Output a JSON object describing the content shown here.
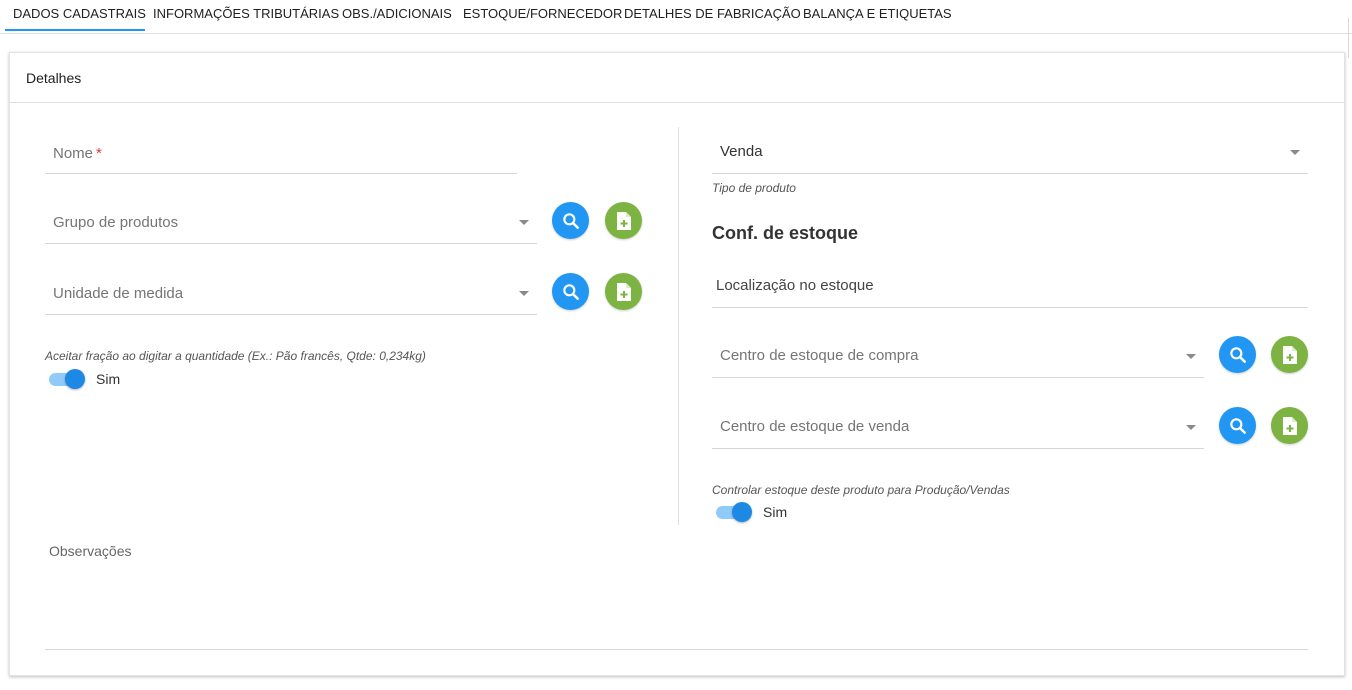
{
  "tabs": [
    {
      "label": "DADOS CADASTRAIS",
      "active": true
    },
    {
      "label": "INFORMAÇÕES TRIBUTÁRIAS",
      "active": false
    },
    {
      "label": "OBS./ADICIONAIS",
      "active": false
    },
    {
      "label": "ESTOQUE/FORNECEDOR",
      "active": false
    },
    {
      "label": "DETALHES DE FABRICAÇÃO",
      "active": false
    },
    {
      "label": "BALANÇA E ETIQUETAS",
      "active": false
    }
  ],
  "card": {
    "title": "Detalhes"
  },
  "left": {
    "nome": {
      "label": "Nome",
      "required_mark": "*"
    },
    "grupo": {
      "placeholder": "Grupo de produtos"
    },
    "unidade": {
      "placeholder": "Unidade de medida"
    },
    "fracao": {
      "hint": "Aceitar fração ao digitar a quantidade (Ex.: Pão francês, Qtde: 0,234kg)",
      "value": "Sim",
      "on": true
    }
  },
  "right": {
    "tipo_produto": {
      "value": "Venda",
      "hint": "Tipo de produto"
    },
    "section_title": "Conf. de estoque",
    "localizacao": {
      "label": "Localização no estoque"
    },
    "centro_compra": {
      "placeholder": "Centro de estoque de compra"
    },
    "centro_venda": {
      "placeholder": "Centro de estoque de venda"
    },
    "controlar": {
      "hint": "Controlar estoque deste produto para Produção/Vendas",
      "value": "Sim",
      "on": true
    }
  },
  "observacoes": {
    "label": "Observações"
  },
  "icons": {
    "search": "search-icon",
    "add": "add-document-icon"
  },
  "colors": {
    "accent": "#2196f3",
    "add_button": "#7cb342",
    "required": "#e53935"
  }
}
